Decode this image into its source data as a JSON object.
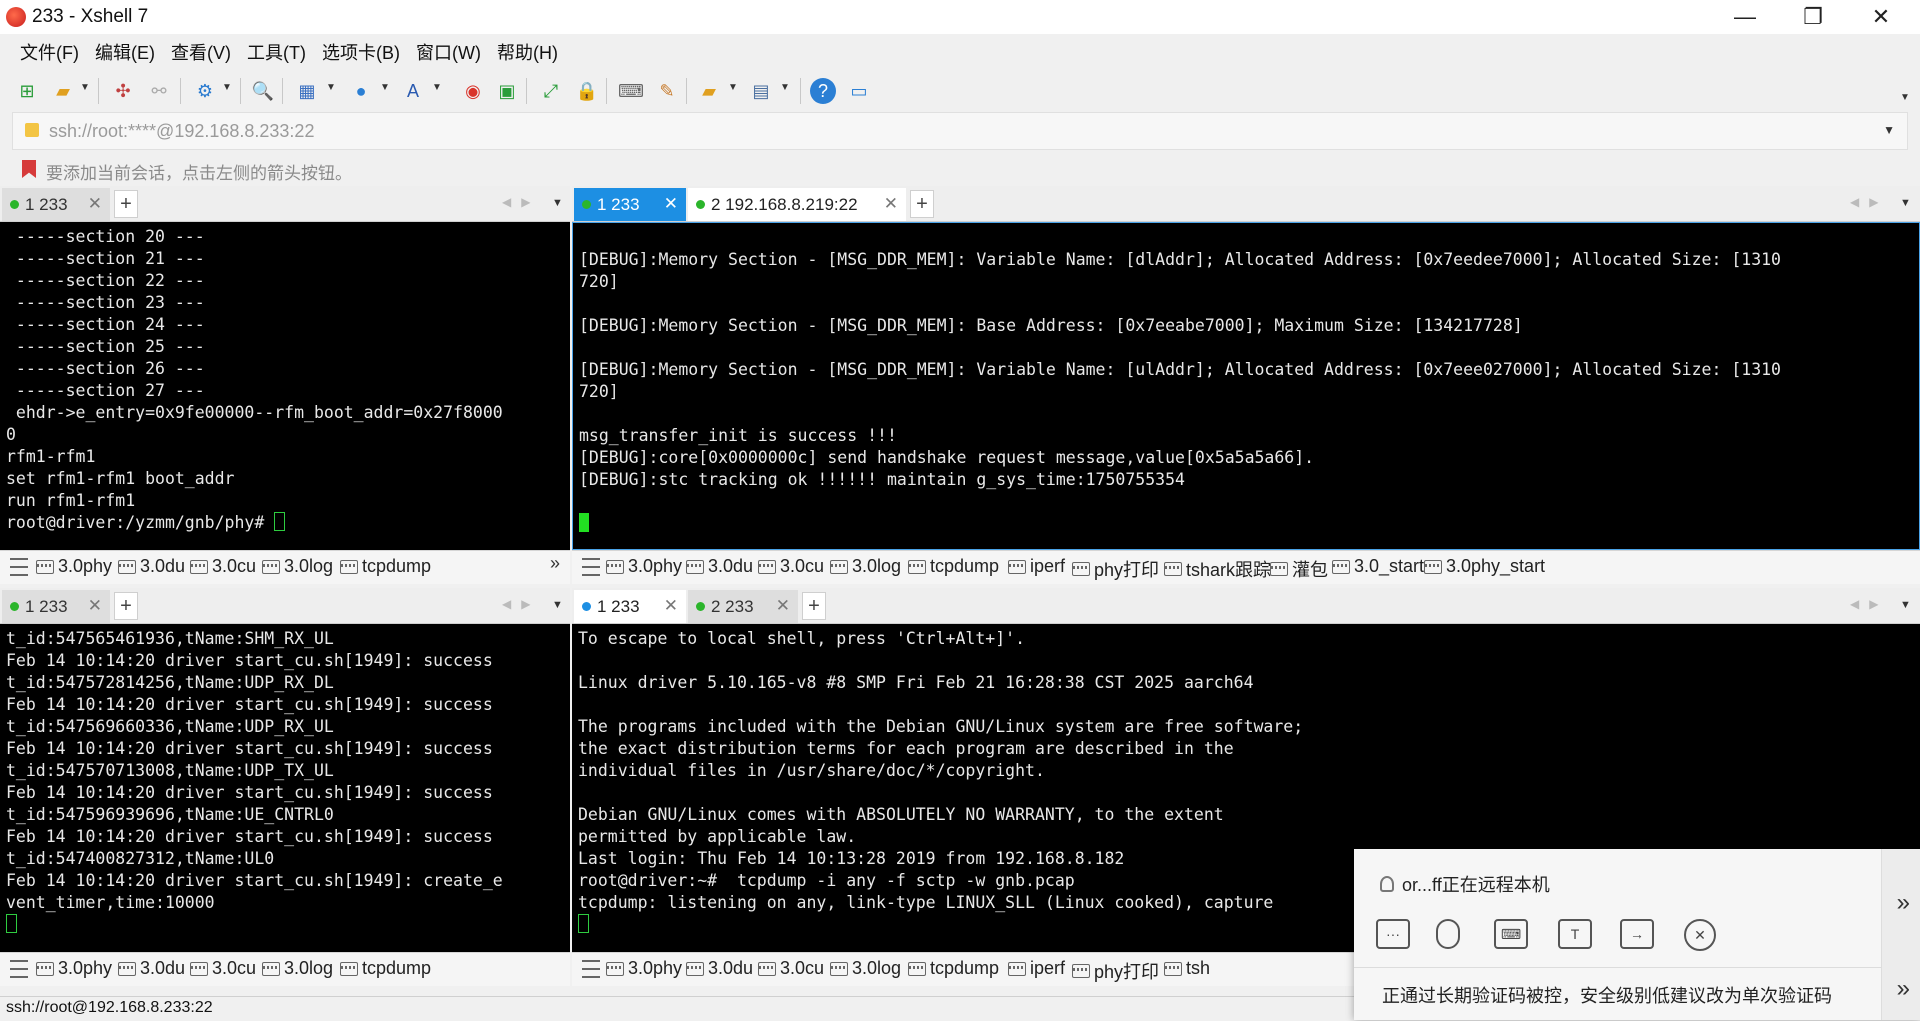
{
  "window": {
    "title": "233 - Xshell 7",
    "controls": [
      "—",
      "❐",
      "✕"
    ]
  },
  "menu": [
    "文件(F)",
    "编辑(E)",
    "查看(V)",
    "工具(T)",
    "选项卡(B)",
    "窗口(W)",
    "帮助(H)"
  ],
  "address": {
    "value": "ssh://root:****@192.168.8.233:22"
  },
  "hint": {
    "text": "要添加当前会话，点击左侧的箭头按钮。"
  },
  "panes": {
    "top_left": {
      "tabs": [
        {
          "label": "1 233",
          "status": "green"
        }
      ],
      "lines": [
        " -----section 20 ---",
        " -----section 21 ---",
        " -----section 22 ---",
        " -----section 23 ---",
        " -----section 24 ---",
        " -----section 25 ---",
        " -----section 26 ---",
        " -----section 27 ---",
        " ehdr->e_entry=0x9fe00000--rfm_boot_addr=0x27f8000",
        "0",
        "rfm1-rfm1",
        "set rfm1-rfm1 boot_addr",
        "run rfm1-rfm1",
        "root@driver:/yzmm/gnb/phy# "
      ],
      "commands": [
        "3.0phy",
        "3.0du",
        "3.0cu",
        "3.0log",
        "tcpdump"
      ]
    },
    "top_right": {
      "tabs": [
        {
          "label": "1 233",
          "status": "green"
        },
        {
          "label": "2 192.168.8.219:22",
          "status": "green"
        }
      ],
      "lines": [
        "",
        "[DEBUG]:Memory Section - [MSG_DDR_MEM]: Variable Name: [dlAddr]; Allocated Address: [0x7eedee7000]; Allocated Size: [1310",
        "720]",
        "",
        "[DEBUG]:Memory Section - [MSG_DDR_MEM]: Base Address: [0x7eeabe7000]; Maximum Size: [134217728]",
        "",
        "[DEBUG]:Memory Section - [MSG_DDR_MEM]: Variable Name: [ulAddr]; Allocated Address: [0x7eee027000]; Allocated Size: [1310",
        "720]",
        "",
        "msg_transfer_init is success !!!",
        "[DEBUG]:core[0x0000000c] send handshake request message,value[0x5a5a5a66].",
        "[DEBUG]:stc tracking ok !!!!!! maintain g_sys_time:1750755354",
        ""
      ],
      "commands": [
        "3.0phy",
        "3.0du",
        "3.0cu",
        "3.0log",
        "tcpdump",
        "iperf",
        "phy打印",
        "tshark跟踪",
        "灌包",
        "3.0_start",
        "3.0phy_start"
      ]
    },
    "bottom_left": {
      "tabs": [
        {
          "label": "1 233",
          "status": "green"
        }
      ],
      "lines": [
        "t_id:547565461936,tName:SHM_RX_UL",
        "Feb 14 10:14:20 driver start_cu.sh[1949]: success",
        "t_id:547572814256,tName:UDP_RX_DL",
        "Feb 14 10:14:20 driver start_cu.sh[1949]: success",
        "t_id:547569660336,tName:UDP_RX_UL",
        "Feb 14 10:14:20 driver start_cu.sh[1949]: success",
        "t_id:547570713008,tName:UDP_TX_UL",
        "Feb 14 10:14:20 driver start_cu.sh[1949]: success",
        "t_id:547596939696,tName:UE_CNTRL0",
        "Feb 14 10:14:20 driver start_cu.sh[1949]: success",
        "t_id:547400827312,tName:UL0",
        "Feb 14 10:14:20 driver start_cu.sh[1949]: create_e",
        "vent_timer,time:10000"
      ],
      "commands": [
        "3.0phy",
        "3.0du",
        "3.0cu",
        "3.0log",
        "tcpdump"
      ]
    },
    "bottom_right": {
      "tabs": [
        {
          "label": "1 233",
          "status": "alert"
        },
        {
          "label": "2 233",
          "status": "green"
        }
      ],
      "lines": [
        "To escape to local shell, press 'Ctrl+Alt+]'.",
        "",
        "Linux driver 5.10.165-v8 #8 SMP Fri Feb 21 16:28:38 CST 2025 aarch64",
        "",
        "The programs included with the Debian GNU/Linux system are free software;",
        "the exact distribution terms for each program are described in the",
        "individual files in /usr/share/doc/*/copyright.",
        "",
        "Debian GNU/Linux comes with ABSOLUTELY NO WARRANTY, to the extent",
        "permitted by applicable law.",
        "Last login: Thu Feb 14 10:13:28 2019 from 192.168.8.182",
        "root@driver:~#  tcpdump -i any -f sctp -w gnb.pcap",
        "tcpdump: listening on any, link-type LINUX_SLL (Linux cooked), capture"
      ],
      "commands": [
        "3.0phy",
        "3.0du",
        "3.0cu",
        "3.0log",
        "tcpdump",
        "iperf",
        "phy打印",
        "tsh"
      ]
    }
  },
  "remote_popup": {
    "user_text": "or...ff正在远程本机",
    "notice": "正通过长期验证码被控，安全级别低建议改为单次验证码",
    "buttons": [
      "chat-icon",
      "microphone-icon",
      "keyboard-icon",
      "text-icon",
      "folder-transfer-icon",
      "close-icon"
    ]
  },
  "status": {
    "text": "ssh://root@192.168.8.233:22"
  },
  "colors": {
    "active_tab": "#1d8fe3",
    "terminal_bg": "#000000",
    "terminal_fg": "#e8e8e8",
    "cursor": "#22e022",
    "session_ok": "#2bb52b"
  }
}
